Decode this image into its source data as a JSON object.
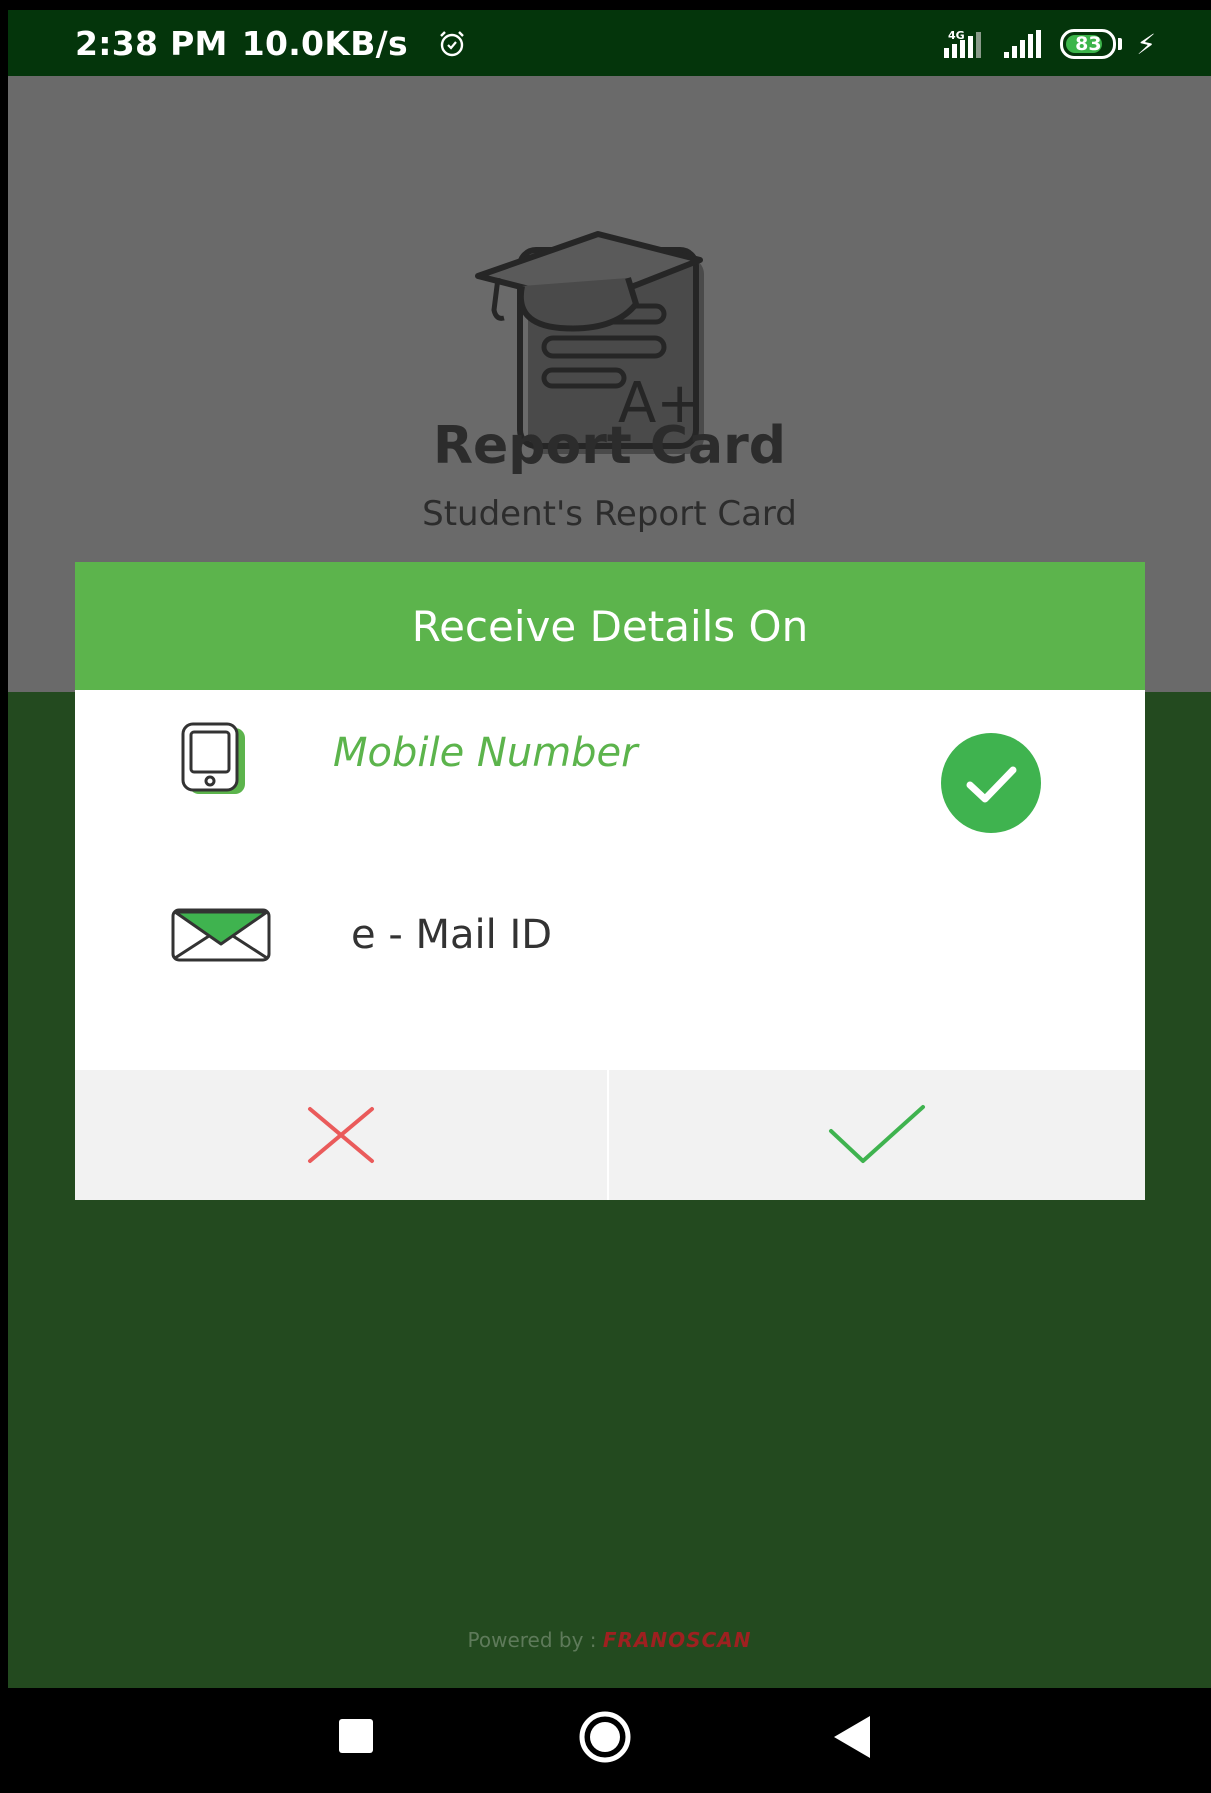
{
  "status_bar": {
    "time": "2:38 PM",
    "speed": "10.0KB/s",
    "network_label": "4G",
    "battery_level": "83",
    "battery_percent": 83
  },
  "app": {
    "title": "Report Card",
    "subtitle": "Student's Report Card"
  },
  "dialog": {
    "title": "Receive Details On",
    "options": [
      {
        "label": "Mobile Number",
        "selected": true
      },
      {
        "label": "e - Mail ID",
        "selected": false
      }
    ]
  },
  "footer": {
    "powered_by": "Powered by :",
    "brand": "FRANOSCAN"
  },
  "colors": {
    "status_bar": "#04350b",
    "header_gray": "#6a6a6a",
    "background_green": "#234a1f",
    "accent_green": "#5cb44c",
    "cancel_red": "#ea5b5b",
    "confirm_green": "#3fb34f"
  },
  "icons": {
    "logo": "graduation-cap-report-icon",
    "mobile": "mobile-phone-icon",
    "email": "envelope-icon",
    "selected": "check-circle-icon",
    "cancel": "close-icon",
    "confirm": "check-icon"
  }
}
